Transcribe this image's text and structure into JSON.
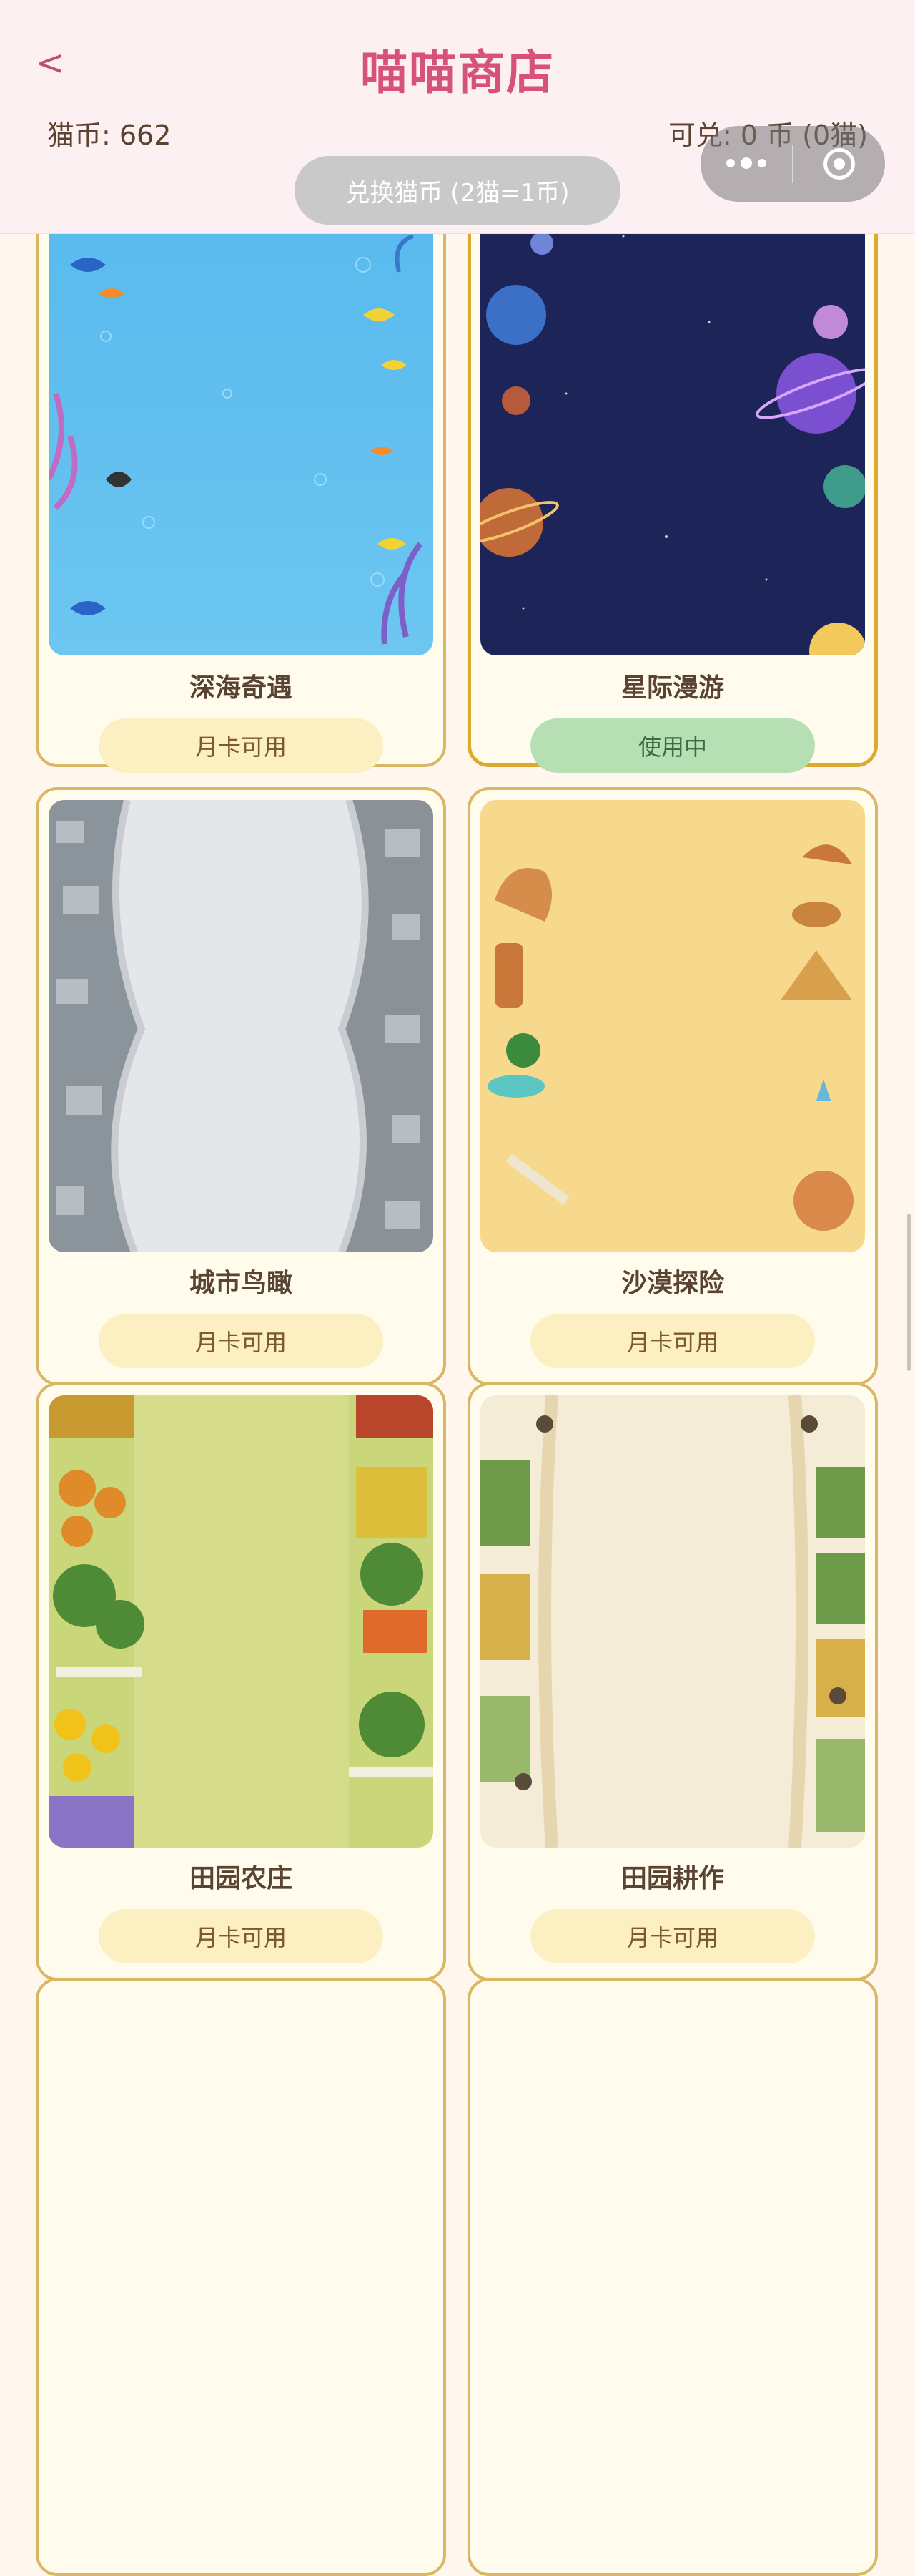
{
  "header": {
    "back_symbol": "<",
    "title": "喵喵商店",
    "coins": "猫币: 662",
    "redeemable": "可兑: 0 币 (0猫)",
    "exchange_button": "兑换猫币 (2猫=1币)"
  },
  "capsule": {
    "more_icon": "more-dots-icon",
    "close_icon": "mini-program-close-icon"
  },
  "themes": [
    {
      "name": "深海奇遇",
      "status": "月卡可用",
      "state": "available",
      "preview": "deep-sea"
    },
    {
      "name": "星际漫游",
      "status": "使用中",
      "state": "in-use",
      "preview": "space"
    },
    {
      "name": "城市鸟瞰",
      "status": "月卡可用",
      "state": "available",
      "preview": "city-aerial"
    },
    {
      "name": "沙漠探险",
      "status": "月卡可用",
      "state": "available",
      "preview": "desert"
    },
    {
      "name": "田园农庄",
      "status": "月卡可用",
      "state": "available",
      "preview": "farm"
    },
    {
      "name": "田园耕作",
      "status": "月卡可用",
      "state": "available",
      "preview": "farming"
    }
  ],
  "colors": {
    "header_bg": "#fdf0f3",
    "title": "#d6527a",
    "card_border": "#d9b764",
    "button_available": "#fcefc2",
    "button_in_use": "#b7dfb4"
  }
}
